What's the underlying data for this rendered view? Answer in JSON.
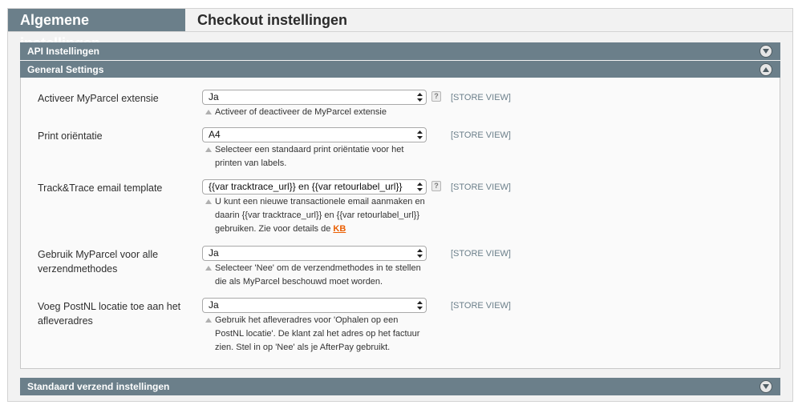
{
  "tabs": [
    {
      "label": "Algemene instellingen",
      "active": true
    },
    {
      "label": "Checkout instellingen",
      "active": false
    }
  ],
  "sections": {
    "api": {
      "title": "API Instellingen",
      "state": "collapsed"
    },
    "general": {
      "title": "General Settings",
      "state": "expanded"
    },
    "shipping": {
      "title": "Standaard verzend instellingen",
      "state": "collapsed"
    }
  },
  "scope_label": "[STORE VIEW]",
  "fields": [
    {
      "label": "Activeer MyParcel extensie",
      "value": "Ja",
      "has_help": true,
      "note": "Activeer of deactiveer de MyParcel extensie"
    },
    {
      "label": "Print oriëntatie",
      "value": "A4",
      "has_help": false,
      "note": "Selecteer een standaard print oriëntatie voor het printen van labels."
    },
    {
      "label": "Track&Trace email template",
      "value": "{{var tracktrace_url}} en {{var retourlabel_url}}",
      "has_help": true,
      "note": "U kunt een nieuwe transactionele email aanmaken en daarin {{var tracktrace_url}} en {{var retourlabel_url}} gebruiken. Zie voor details de",
      "note_link": "KB"
    },
    {
      "label": "Gebruik MyParcel voor alle verzendmethodes",
      "value": "Ja",
      "has_help": false,
      "note": "Selecteer 'Nee' om de verzendmethodes in te stellen die als MyParcel beschouwd moet worden."
    },
    {
      "label": "Voeg PostNL locatie toe aan het afleveradres",
      "value": "Ja",
      "has_help": false,
      "note": "Gebruik het afleveradres voor 'Ophalen op een PostNL locatie'. De klant zal het adres op het factuur zien. Stel in op 'Nee' als je AfterPay gebruikt."
    }
  ],
  "help_glyph": "?",
  "colors": {
    "header_bar": "#6b7f8a",
    "link": "#eb5e00",
    "scope_text": "#6b7f8a"
  }
}
